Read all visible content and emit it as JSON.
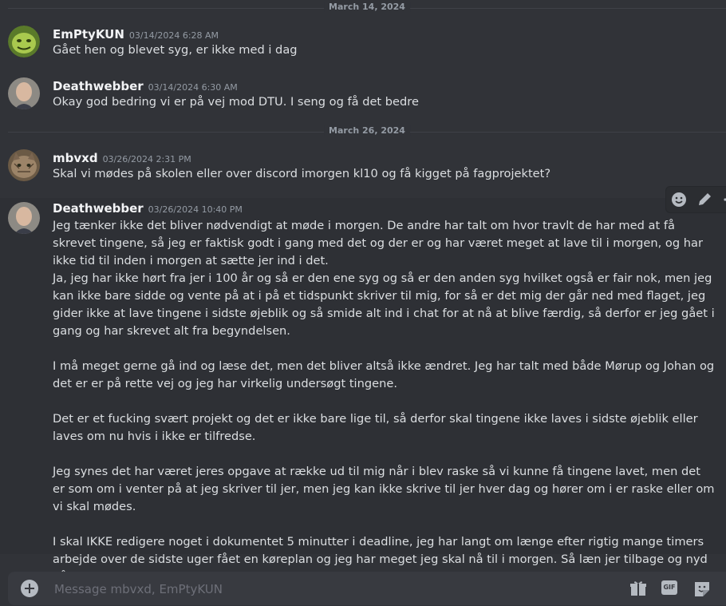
{
  "dividers": [
    "March 14, 2024",
    "March 26, 2024"
  ],
  "messages": [
    {
      "username": "EmPtyKUN",
      "timestamp": "03/14/2024 6:28 AM",
      "paragraphs": [
        "Gået hen og blevet syg, er ikke med i dag"
      ]
    },
    {
      "username": "Deathwebber",
      "timestamp": "03/14/2024 6:30 AM",
      "paragraphs": [
        "Okay god bedring vi er på vej mod DTU. I seng og få det bedre"
      ]
    },
    {
      "username": "mbvxd",
      "timestamp": "03/26/2024 2:31 PM",
      "paragraphs": [
        "Skal vi mødes på skolen eller over discord imorgen kl10 og få kigget på fagprojektet?"
      ]
    },
    {
      "username": "Deathwebber",
      "timestamp": "03/26/2024 10:40 PM",
      "paragraphs": [
        "Jeg tænker ikke det bliver nødvendigt at møde i morgen. De andre har talt om hvor travlt de har med at få skrevet tingene, så jeg er faktisk godt i gang med det og der er og har været meget at lave til i morgen, og har ikke tid til inden i morgen at sætte jer ind i det.",
        "Ja, jeg har ikke hørt fra jer i 100 år og så er den ene syg og så er den anden syg hvilket også er fair nok, men jeg kan ikke bare sidde og vente på at i på et tidspunkt skriver til mig, for så er det mig der går ned med flaget, jeg gider ikke at lave tingene i sidste øjeblik og så smide alt ind i chat for at nå at blive færdig, så derfor er jeg gået i gang og har skrevet alt fra begyndelsen.",
        "",
        "I må meget gerne gå ind og læse det, men det bliver altså ikke ændret. Jeg har talt med både Mørup og Johan og det er er på rette vej og jeg har virkelig undersøgt tingene.",
        "",
        "Det er et fucking svært projekt og det er ikke bare lige til, så derfor skal tingene ikke laves i sidste øjeblik eller laves om nu hvis i ikke er tilfredse.",
        "",
        "Jeg synes det har været jeres opgave at række ud til mig når i blev raske så vi kunne få tingene lavet, men det er som om i venter på at jeg skriver til jer, men jeg kan ikke skrive til jer hver dag og hører om i er raske eller om vi skal mødes.",
        "",
        "I skal IKKE redigere noget i dokumentet 5 minutter i deadline, jeg har langt om længe efter rigtig mange timers arbejde over de sidste uger fået en køreplan og jeg har meget jeg skal nå til i morgen. Så læn jer tilbage og nyd påskeferien."
      ]
    }
  ],
  "composer": {
    "placeholder": "Message mbvxd, EmPtyKUN",
    "gif_label": "GIF"
  },
  "icons": {
    "attach": "plus-circle-icon",
    "gift": "gift-icon",
    "gif": "gif-icon",
    "sticker": "sticker-icon",
    "react": "emoji-react-icon",
    "edit": "pencil-icon"
  }
}
